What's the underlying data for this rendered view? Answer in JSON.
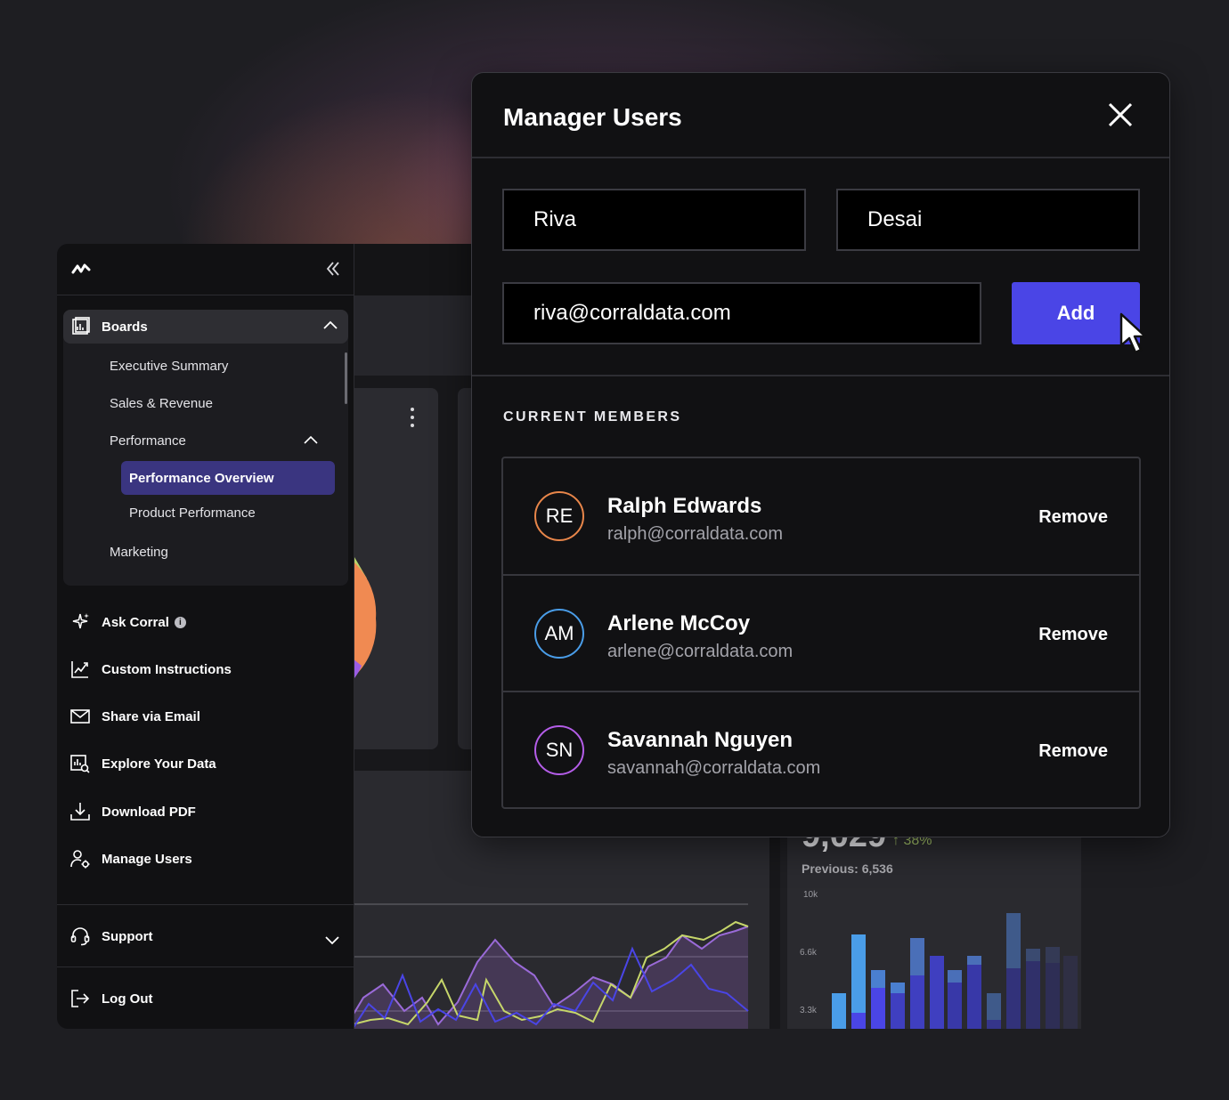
{
  "sidebar": {
    "boards_label": "Boards",
    "boards_items": [
      "Executive Summary",
      "Sales & Revenue",
      "Performance"
    ],
    "performance_children": [
      "Performance Overview",
      "Product Performance"
    ],
    "marketing_label": "Marketing",
    "menu": [
      {
        "label": "Ask Corral",
        "icon": "sparkle-icon"
      },
      {
        "label": "Custom Instructions",
        "icon": "chart-edit-icon"
      },
      {
        "label": "Share via Email",
        "icon": "mail-icon"
      },
      {
        "label": "Explore Your Data",
        "icon": "search-data-icon"
      },
      {
        "label": "Download PDF",
        "icon": "download-icon"
      },
      {
        "label": "Manage Users",
        "icon": "users-gear-icon"
      }
    ],
    "support_label": "Support",
    "logout_label": "Log Out",
    "active_item": "Performance Overview"
  },
  "modal": {
    "title": "Manager Users",
    "first_name": "Riva",
    "last_name": "Desai",
    "email": "riva@corraldata.com",
    "add_label": "Add",
    "members_heading": "CURRENT MEMBERS",
    "members": [
      {
        "initials": "RE",
        "name": "Ralph Edwards",
        "email": "ralph@corraldata.com",
        "remove": "Remove",
        "ring": "#e8864a"
      },
      {
        "initials": "AM",
        "name": "Arlene McCoy",
        "email": "arlene@corraldata.com",
        "remove": "Remove",
        "ring": "#4a9de8"
      },
      {
        "initials": "SN",
        "name": "Savannah Nguyen",
        "email": "savannah@corraldata.com",
        "remove": "Remove",
        "ring": "#b45de8"
      }
    ]
  },
  "background_dashboard": {
    "metric_pct": "↑ 38%",
    "previous_label": "Previous: 6,536",
    "bar_axis_labels": [
      "10k",
      "6.6k",
      "3.3k"
    ]
  },
  "colors": {
    "accent": "#4a45e6",
    "active_nav": "#3a3580",
    "background": "#1e1e22",
    "panel": "#111113"
  }
}
